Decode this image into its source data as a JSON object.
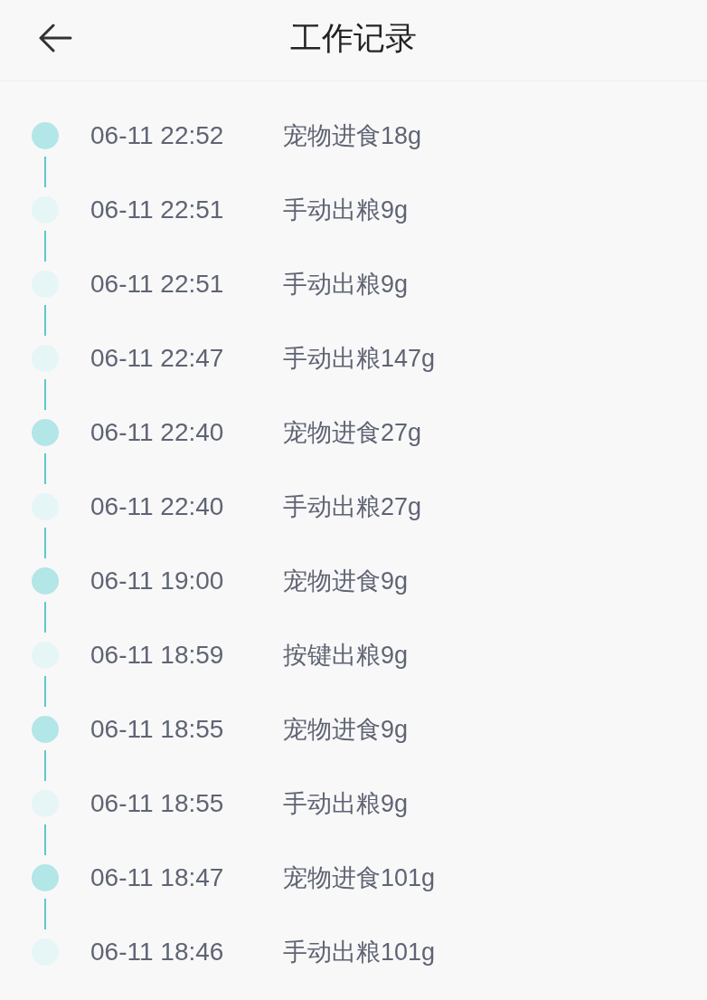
{
  "header": {
    "title": "工作记录"
  },
  "records": [
    {
      "time": "06-11 22:52",
      "event": "宠物进食18g",
      "color": "#b3e6e6"
    },
    {
      "time": "06-11 22:51",
      "event": "手动出粮9g",
      "color": "#e6f5f5"
    },
    {
      "time": "06-11 22:51",
      "event": "手动出粮9g",
      "color": "#e6f5f5"
    },
    {
      "time": "06-11 22:47",
      "event": "手动出粮147g",
      "color": "#e6f5f5"
    },
    {
      "time": "06-11 22:40",
      "event": "宠物进食27g",
      "color": "#b3e6e6"
    },
    {
      "time": "06-11 22:40",
      "event": "手动出粮27g",
      "color": "#e6f5f5"
    },
    {
      "time": "06-11 19:00",
      "event": "宠物进食9g",
      "color": "#b3e6e6"
    },
    {
      "time": "06-11 18:59",
      "event": "按键出粮9g",
      "color": "#e6f5f5"
    },
    {
      "time": "06-11 18:55",
      "event": "宠物进食9g",
      "color": "#b3e6e6"
    },
    {
      "time": "06-11 18:55",
      "event": "手动出粮9g",
      "color": "#e6f5f5"
    },
    {
      "time": "06-11 18:47",
      "event": "宠物进食101g",
      "color": "#b3e6e6"
    },
    {
      "time": "06-11 18:46",
      "event": "手动出粮101g",
      "color": "#e6f5f5"
    }
  ]
}
